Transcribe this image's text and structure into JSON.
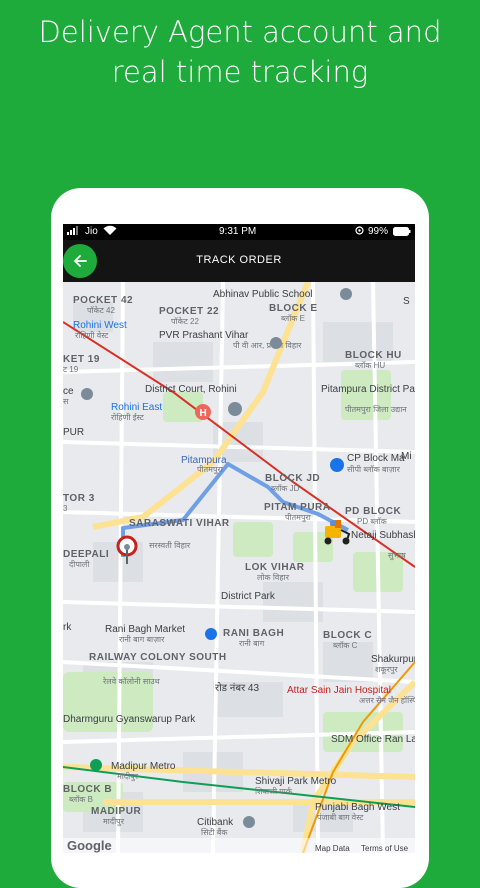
{
  "headline": {
    "line1": "Delivery Agent account and",
    "line2": "real time tracking"
  },
  "status_bar": {
    "carrier": "Jio",
    "time": "9:31 PM",
    "battery": "99%"
  },
  "app_bar": {
    "title": "TRACK ORDER",
    "back_icon": "arrow-left-icon"
  },
  "map": {
    "areas": [
      {
        "name": "POCKET 42",
        "sub": "पॉकेट 42"
      },
      {
        "name": "POCKET 22",
        "sub": "पॉकेट 22"
      },
      {
        "name": "BLOCK E",
        "sub": "ब्लॉक E"
      },
      {
        "name": "BLOCK HU",
        "sub": "ब्लॉक HU"
      },
      {
        "name": "BLOCK JD",
        "sub": "ब्लॉक JD"
      },
      {
        "name": "PITAM PURA",
        "sub": "पीतमपुरा"
      },
      {
        "name": "PD BLOCK",
        "sub": "PD ब्लॉक"
      },
      {
        "name": "SARASWATI VIHAR",
        "sub": "सरस्वती विहार"
      },
      {
        "name": "LOK VIHAR",
        "sub": "लोक विहार"
      },
      {
        "name": "RANI BAGH",
        "sub": "रानी बाग"
      },
      {
        "name": "BLOCK C",
        "sub": "ब्लॉक C"
      },
      {
        "name": "RAILWAY COLONY SOUTH",
        "sub": "रेलवे कॉलोनी साउथ"
      },
      {
        "name": "BLOCK B",
        "sub": "ब्लॉक B"
      },
      {
        "name": "MADIPUR",
        "sub": "मादीपुर"
      },
      {
        "name": "DEEPALI",
        "sub": "दीपाली"
      },
      {
        "name": "KET 19",
        "sub": "ट 19"
      },
      {
        "name": "TOR 3",
        "sub": "3"
      }
    ],
    "pois": [
      {
        "name": "Abhinav Public School"
      },
      {
        "name": "Rohini West",
        "sub": "रोहिणी वेस्ट"
      },
      {
        "name": "PVR Prashant Vihar",
        "sub": "पी वी आर, प्रशांत विहार"
      },
      {
        "name": "District Court, Rohini"
      },
      {
        "name": "Rohini East",
        "sub": "रोहिणी ईस्ट"
      },
      {
        "name": "Pitampura District Park",
        "sub": "पीतमपुरा जिला उद्यान"
      },
      {
        "name": "CP Block Ma",
        "sub": "सीपी ब्लॉक बाज़ार"
      },
      {
        "name": "Pitampura",
        "sub": "पीतमपुरा"
      },
      {
        "name": "Netaji Subhash P",
        "sub": "सुभाष"
      },
      {
        "name": "District Park"
      },
      {
        "name": "Rani Bagh Market",
        "sub": "रानी बाग बाज़ार"
      },
      {
        "name": "Shakurpur",
        "sub": "शकूरपुर"
      },
      {
        "name": "Attar Sain Jain Hospital",
        "sub": "अत्तर सैन जैन हॉस्पिटल"
      },
      {
        "name": "Dharmguru Gyanswarup Park"
      },
      {
        "name": "SDM Office Ran Lawrence"
      },
      {
        "name": "Madipur Metro",
        "sub": "मादीपुर"
      },
      {
        "name": "Shivaji Park Metro",
        "sub": "शिवाजी पार्क"
      },
      {
        "name": "Punjabi Bagh West",
        "sub": "पंजाबी बाग वेस्ट"
      },
      {
        "name": "Citibank",
        "sub": "सिटी बैंक"
      },
      {
        "name": "ce",
        "sub": "स"
      },
      {
        "name": "PUR"
      },
      {
        "name": "Mi"
      },
      {
        "name": "rk"
      }
    ],
    "road_labels": [
      "रोड नंबर 43"
    ],
    "footer": {
      "logo": "Google",
      "map_data": "Map Data",
      "terms": "Terms of Use"
    }
  },
  "colors": {
    "background": "#1faa3c",
    "route": "#6f9fe6",
    "metro_red": "#d93025",
    "metro_green": "#0f9d58"
  }
}
